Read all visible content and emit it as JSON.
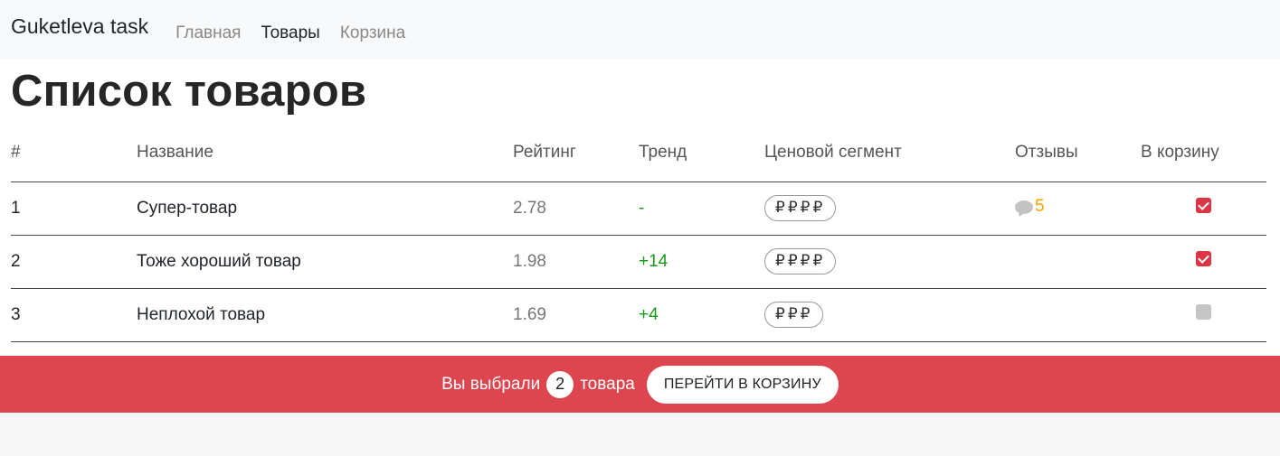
{
  "navbar": {
    "brand": "Guketleva task",
    "links": [
      "Главная",
      "Товары",
      "Корзина"
    ]
  },
  "page_title": "Список товаров",
  "table": {
    "headers": [
      "#",
      "Название",
      "Рейтинг",
      "Тренд",
      "Ценовой сегмент",
      "Отзывы",
      "В корзину"
    ],
    "rows": [
      {
        "num": "1",
        "name": "Супер-товар",
        "rating": "2.78",
        "trend": "-",
        "segment": "₽₽₽₽",
        "reviews": "5",
        "in_cart": true
      },
      {
        "num": "2",
        "name": "Тоже хороший товар",
        "rating": "1.98",
        "trend": "+14",
        "segment": "₽₽₽₽",
        "reviews": "",
        "in_cart": true
      },
      {
        "num": "3",
        "name": "Неплохой товар",
        "rating": "1.69",
        "trend": "+4",
        "segment": "₽₽₽",
        "reviews": "",
        "in_cart": false
      }
    ]
  },
  "banner": {
    "prefix": "Вы выбрали",
    "count": "2",
    "suffix": "товара",
    "button": "ПЕРЕЙТИ В КОРЗИНУ"
  },
  "colors": {
    "accent": "#dd464f",
    "trend": "#1a9a1a",
    "reviews": "#f0a500"
  }
}
